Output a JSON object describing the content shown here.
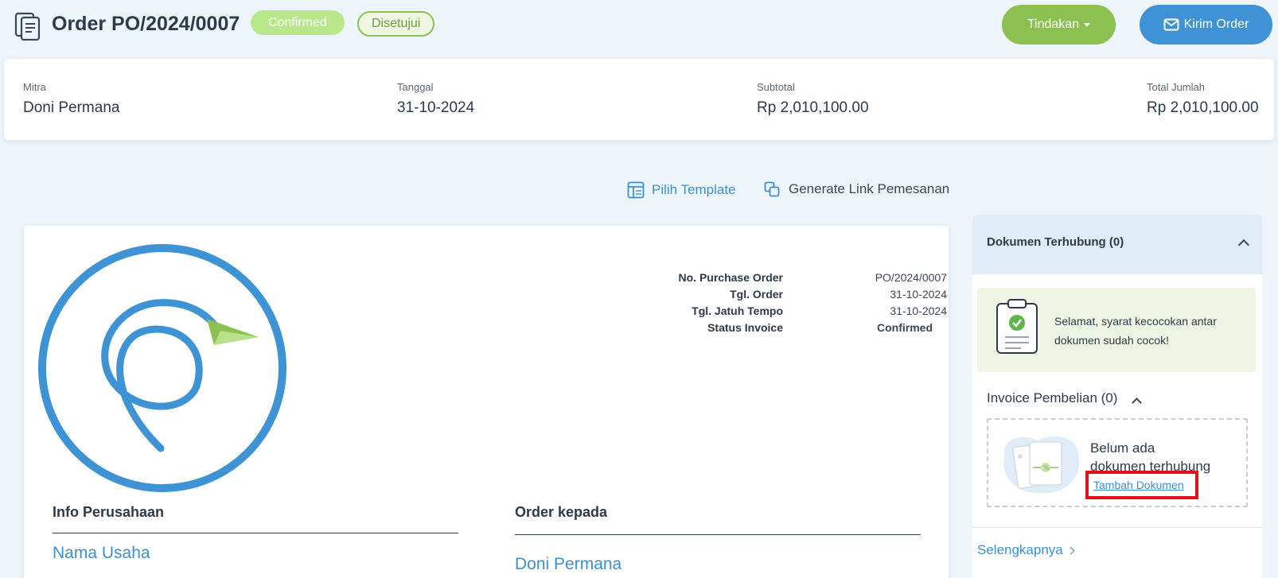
{
  "header": {
    "title": "Order PO/2024/0007",
    "status_badge": "Confirmed",
    "approval_badge": "Disetujui",
    "action_button": "Tindakan",
    "send_button": "Kirim Order"
  },
  "summary": {
    "partner_label": "Mitra",
    "partner_value": "Doni Permana",
    "date_label": "Tanggal",
    "date_value": "31-10-2024",
    "subtotal_label": "Subtotal",
    "subtotal_value": "Rp 2,010,100.00",
    "total_label": "Total Jumlah",
    "total_value": "Rp 2,010,100.00"
  },
  "links": {
    "template": "Pilih Template",
    "generate": "Generate Link Pemesanan"
  },
  "document": {
    "meta": [
      {
        "label": "No. Purchase Order",
        "value": "PO/2024/0007"
      },
      {
        "label": "Tgl. Order",
        "value": "31-10-2024"
      },
      {
        "label": "Tgl. Jatuh Tempo",
        "value": "31-10-2024"
      },
      {
        "label": "Status Invoice",
        "value": "Confirmed"
      }
    ],
    "company_title": "Info Perusahaan",
    "company_name": "Nama Usaha",
    "order_to_title": "Order kepada",
    "order_to_name": "Doni Permana"
  },
  "panel": {
    "title": "Dokumen Terhubung (0)",
    "success_message": "Selamat, syarat kecocokan antar dokumen sudah cocok!",
    "invoice_header": "Invoice Pembelian (0)",
    "empty_line1": "Belum ada",
    "empty_line2": "dokumen terhubung",
    "add_document": "Tambah Dokumen",
    "more_link": "Selengkapnya"
  },
  "colors": {
    "accent_blue": "#3d93d3",
    "accent_green": "#8cc152",
    "highlight_red": "#e0141c"
  }
}
